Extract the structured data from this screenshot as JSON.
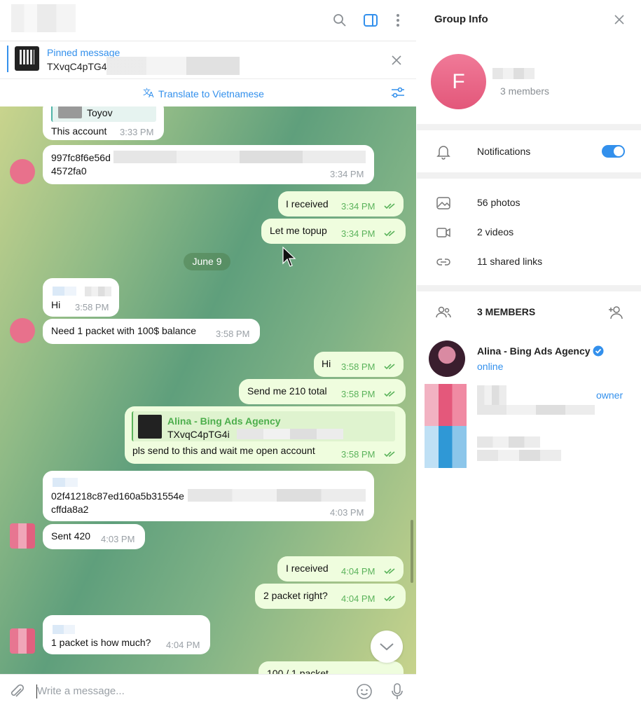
{
  "pinned": {
    "title": "Pinned message",
    "text": "TXvqC4pTG4"
  },
  "translate": {
    "label": "Translate to Vietnamese"
  },
  "messages": {
    "m1": {
      "reply_name": "Toyov",
      "text": "This account",
      "time": "3:33 PM"
    },
    "m2": {
      "line1": "997fc8f6e56d",
      "line2": "4572fa0",
      "time": "3:34 PM"
    },
    "m3": {
      "text": "I received",
      "time": "3:34 PM"
    },
    "m4": {
      "text": "Let me topup",
      "time": "3:34 PM"
    },
    "date": "June 9",
    "m5": {
      "text": "Hi",
      "time": "3:58 PM"
    },
    "m6": {
      "text": "Need 1 packet with 100$ balance",
      "time": "3:58 PM"
    },
    "m7": {
      "text": "Hi",
      "time": "3:58 PM"
    },
    "m8": {
      "text": "Send me 210 total",
      "time": "3:58 PM"
    },
    "m9": {
      "reply_name": "Alina - Bing Ads Agency",
      "reply_text": "TXvqC4pTG4i",
      "text": "pls send to this and wait me open account",
      "time": "3:58 PM"
    },
    "m10": {
      "line1": "02f41218c87ed160a5b31554e",
      "line2": "cffda8a2",
      "time": "4:03 PM"
    },
    "m11": {
      "text": "Sent 420",
      "time": "4:03 PM"
    },
    "m12": {
      "text": "I received",
      "time": "4:04 PM"
    },
    "m13": {
      "text": "2 packet right?",
      "time": "4:04 PM"
    },
    "m14": {
      "text": "1 packet is how much?",
      "time": "4:04 PM"
    },
    "m15": {
      "text": "100 / 1 packet"
    }
  },
  "composer": {
    "placeholder": "Write a message..."
  },
  "info": {
    "title": "Group Info",
    "avatar_letter": "F",
    "member_count": "3 members",
    "notifications": "Notifications",
    "notifications_on": true,
    "photos": "56 photos",
    "videos": "2 videos",
    "links": "11 shared links",
    "members_header": "3 MEMBERS",
    "member1_name": "Alina - Bing Ads Agency",
    "member1_status": "online",
    "owner_label": "owner"
  },
  "colors": {
    "accent": "#3390ec",
    "outgoing": "#effdde",
    "avatar": "#e8718c"
  }
}
